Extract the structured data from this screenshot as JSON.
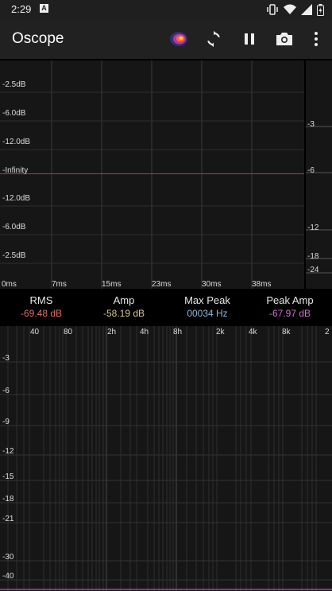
{
  "status_bar": {
    "time": "2:29",
    "notification_letter": "A"
  },
  "app_bar": {
    "title": "Oscope",
    "actions": [
      "color-theme-icon",
      "refresh-icon",
      "pause-icon",
      "camera-icon",
      "more-vert-icon"
    ]
  },
  "scope": {
    "left_labels": [
      "-2.5dB",
      "-6.0dB",
      "-12.0dB",
      "-Infinity",
      "-12.0dB",
      "-6.0dB",
      "-2.5dB"
    ],
    "right_labels": [
      "-3",
      "-6",
      "-12",
      "-18",
      "-24"
    ],
    "time_labels": [
      "0ms",
      "7ms",
      "15ms",
      "23ms",
      "30ms",
      "38ms"
    ],
    "trace_color": "#c0392b"
  },
  "stats": [
    {
      "label": "RMS",
      "value": "-69.48 dB",
      "color": "#e06c6c"
    },
    {
      "label": "Amp",
      "value": "-58.19 dB",
      "color": "#d8c78a"
    },
    {
      "label": "Max Peak",
      "value": "00034 Hz",
      "color": "#8fb7d9"
    },
    {
      "label": "Peak Amp",
      "value": "-67.97 dB",
      "color": "#d26ad2"
    }
  ],
  "spectrum": {
    "freq_labels": [
      "40",
      "80",
      "2h",
      "4h",
      "8h",
      "2k",
      "4k",
      "8k",
      "2"
    ],
    "db_labels": [
      "-3",
      "-6",
      "-9",
      "-12",
      "-15",
      "-18",
      "-21",
      "-30",
      "-40"
    ],
    "baseline_color": "#b03ab0"
  }
}
